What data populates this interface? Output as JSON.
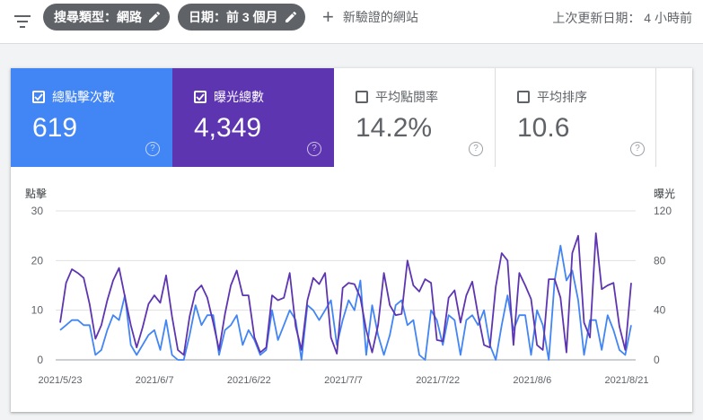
{
  "toolbar": {
    "chip_search_type": "搜尋類型：網路",
    "chip_date": "日期：前 3 個月",
    "new_comparison": "新驗證的網站",
    "last_updated": "上次更新日期： 4 小時前",
    "filter_icon": "filter-icon",
    "pencil_icon": "pencil-icon",
    "plus_icon": "plus-icon",
    "help_icon": "help-icon"
  },
  "metrics": [
    {
      "label": "總點擊次數",
      "value": "619",
      "checked": true,
      "color": "#4285f4"
    },
    {
      "label": "曝光總數",
      "value": "4,349",
      "checked": true,
      "color": "#5e35b1"
    },
    {
      "label": "平均點閱率",
      "value": "14.2%",
      "checked": false,
      "color": "#ffffff"
    },
    {
      "label": "平均排序",
      "value": "10.6",
      "checked": false,
      "color": "#ffffff"
    }
  ],
  "chart_data": {
    "type": "line",
    "ylabel_left": "點擊",
    "ylabel_right": "曝光",
    "ylim_left": [
      0,
      30
    ],
    "ylim_right": [
      0,
      120
    ],
    "yticks_left": [
      "30",
      "20",
      "10",
      "0"
    ],
    "yticks_right": [
      "120",
      "80",
      "40",
      "0"
    ],
    "x_ticks": [
      "2021/5/23",
      "2021/6/7",
      "2021/6/22",
      "2021/7/7",
      "2021/7/22",
      "2021/8/6",
      "2021/8/21"
    ],
    "grid": true,
    "series": [
      {
        "name": "點擊",
        "axis": "left",
        "color": "#4285f4",
        "values": [
          6,
          7,
          8,
          8,
          7,
          7,
          1,
          2,
          6,
          9,
          8,
          13,
          3,
          1,
          3,
          5,
          6,
          2,
          8,
          1,
          0,
          0,
          5,
          11,
          7,
          9,
          9,
          1,
          6,
          7,
          9,
          3,
          6,
          4,
          1,
          2,
          10,
          4,
          7,
          10,
          8,
          0,
          11,
          10,
          8,
          10,
          12,
          3,
          8,
          12,
          10,
          16,
          1,
          11,
          5,
          1,
          5,
          11,
          12,
          7,
          8,
          1,
          0,
          10,
          8,
          3,
          9,
          8,
          1,
          8,
          9,
          7,
          10,
          3,
          0,
          7,
          13,
          6,
          9,
          9,
          1,
          10,
          7,
          0,
          16,
          23,
          16,
          18,
          12,
          1,
          8,
          8,
          2,
          9,
          6,
          2,
          1,
          7
        ]
      },
      {
        "name": "曝光",
        "axis": "right",
        "color": "#5e35b1",
        "values": [
          30,
          62,
          73,
          70,
          66,
          45,
          17,
          28,
          48,
          64,
          74,
          51,
          28,
          10,
          26,
          45,
          52,
          46,
          68,
          35,
          8,
          4,
          35,
          55,
          60,
          50,
          30,
          8,
          37,
          60,
          72,
          52,
          52,
          18,
          6,
          10,
          52,
          48,
          50,
          70,
          27,
          8,
          48,
          66,
          61,
          70,
          18,
          5,
          58,
          62,
          61,
          50,
          24,
          6,
          28,
          70,
          44,
          36,
          37,
          80,
          60,
          55,
          65,
          62,
          16,
          15,
          50,
          56,
          30,
          52,
          63,
          36,
          12,
          10,
          59,
          86,
          80,
          12,
          70,
          60,
          49,
          12,
          8,
          65,
          65,
          50,
          6,
          86,
          100,
          30,
          18,
          102,
          57,
          60,
          62,
          27,
          8,
          62
        ]
      }
    ]
  }
}
